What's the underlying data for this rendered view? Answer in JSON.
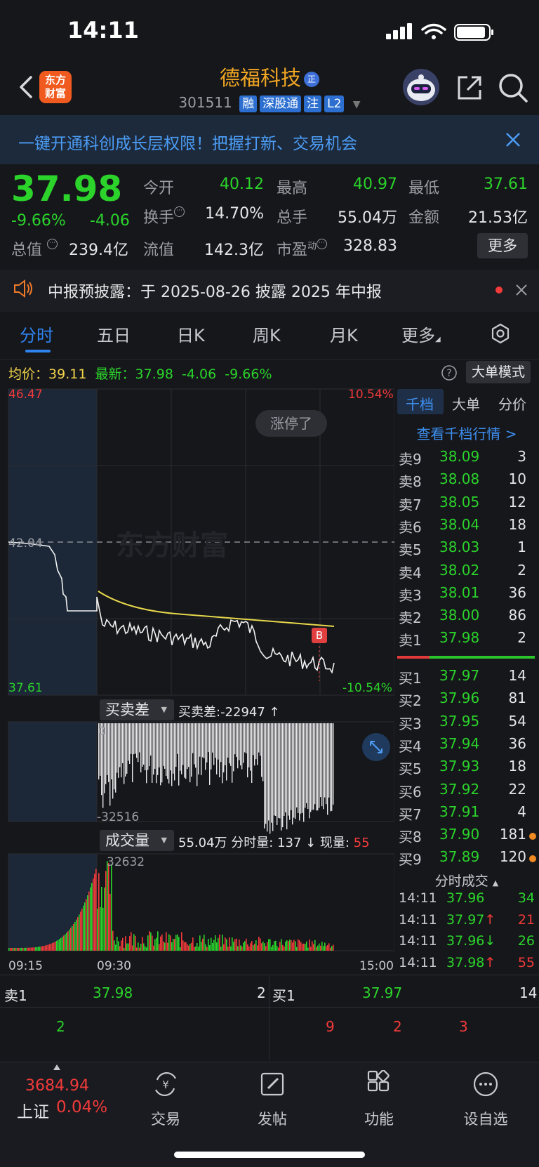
{
  "status": {
    "time": "14:11"
  },
  "header": {
    "logo_text_1": "东方",
    "logo_text_2": "财富",
    "stock_name": "德福科技",
    "name_badge": "正",
    "code": "301511",
    "tags": [
      "融",
      "深股通",
      "注",
      "L2"
    ]
  },
  "banner": {
    "text": "一键开通科创成长层权限！把握打新、交易机会"
  },
  "quote": {
    "price": "37.98",
    "pct": "-9.66%",
    "change": "-4.06",
    "market_cap_label": "总值",
    "market_cap": "239.4亿",
    "open_label": "今开",
    "open": "40.12",
    "high_label": "最高",
    "high": "40.97",
    "low_label": "最低",
    "low": "37.61",
    "turnover_label": "换手",
    "turnover": "14.70%",
    "volume_label": "总手",
    "volume": "55.04万",
    "amount_label": "金额",
    "amount": "21.53亿",
    "float_label": "流值",
    "float_cap": "142.3亿",
    "pe_label": "市盈",
    "pe_sup": "动",
    "pe": "328.83",
    "more_button": "更多"
  },
  "notice": {
    "text": "中报预披露：于 2025-08-26 披露 2025 年中报"
  },
  "tabs": [
    "分时",
    "五日",
    "日K",
    "周K",
    "月K",
    "更多"
  ],
  "avg_row": {
    "avg_label": "均价：",
    "avg": "39.11",
    "latest_label": "最新：",
    "latest": "37.98",
    "change": "-4.06",
    "pct": "-9.66%",
    "big_order_button": "大单模式"
  },
  "chart": {
    "top_price": "46.47",
    "top_pct": "10.54%",
    "bottom_price": "37.61",
    "bottom_pct": "-10.54%",
    "prev_close": "42.04",
    "limit_pill": "涨停了",
    "marker": "B",
    "diff_indicator": "买卖差",
    "diff_text": "买卖差:-22947 ↑",
    "diff_zero": "0",
    "diff_min": "-32516",
    "vol_indicator": "成交量",
    "vol_text_1": "55.04万 分时量: 137 ↓ 现量: ",
    "vol_now": "55",
    "vol_max": "32632",
    "time_start": "09:15",
    "time_open": "09:30",
    "time_end": "15:00",
    "watermark": "东方财富"
  },
  "colors": {
    "up": "#f23a3a",
    "down": "#2bd32b",
    "avg_line": "#e7d84b",
    "accent": "#2f83f0"
  },
  "side": {
    "tabs": [
      "千档",
      "大单",
      "分价"
    ],
    "link": "查看千档行情 >",
    "asks": [
      {
        "name": "卖9",
        "price": "38.09",
        "vol": "3"
      },
      {
        "name": "卖8",
        "price": "38.08",
        "vol": "10"
      },
      {
        "name": "卖7",
        "price": "38.05",
        "vol": "12"
      },
      {
        "name": "卖6",
        "price": "38.04",
        "vol": "18"
      },
      {
        "name": "卖5",
        "price": "38.03",
        "vol": "1"
      },
      {
        "name": "卖4",
        "price": "38.02",
        "vol": "2"
      },
      {
        "name": "卖3",
        "price": "38.01",
        "vol": "36"
      },
      {
        "name": "卖2",
        "price": "38.00",
        "vol": "86"
      },
      {
        "name": "卖1",
        "price": "37.98",
        "vol": "2"
      }
    ],
    "bids": [
      {
        "name": "买1",
        "price": "37.97",
        "vol": "14"
      },
      {
        "name": "买2",
        "price": "37.96",
        "vol": "81"
      },
      {
        "name": "买3",
        "price": "37.95",
        "vol": "54"
      },
      {
        "name": "买4",
        "price": "37.94",
        "vol": "36"
      },
      {
        "name": "买5",
        "price": "37.93",
        "vol": "18"
      },
      {
        "name": "买6",
        "price": "37.92",
        "vol": "22"
      },
      {
        "name": "买7",
        "price": "37.91",
        "vol": "4"
      },
      {
        "name": "买8",
        "price": "37.90",
        "vol": "181"
      },
      {
        "name": "买9",
        "price": "37.89",
        "vol": "120"
      }
    ],
    "ticks_title": "分时成交",
    "ticks": [
      {
        "time": "14:11",
        "price": "37.96",
        "arrow": "",
        "vol": "34",
        "dir": "down"
      },
      {
        "time": "14:11",
        "price": "37.97",
        "arrow": "↑",
        "vol": "21",
        "dir": "up"
      },
      {
        "time": "14:11",
        "price": "37.96",
        "arrow": "↓",
        "vol": "26",
        "dir": "down"
      },
      {
        "time": "14:11",
        "price": "37.98",
        "arrow": "↑",
        "vol": "55",
        "dir": "up"
      }
    ]
  },
  "strip": {
    "ask_label": "卖1",
    "ask_price": "37.98",
    "ask_vol": "2",
    "bid_label": "买1",
    "bid_price": "37.97",
    "bid_vol": "14",
    "ask_queue": [
      "2"
    ],
    "bid_queue": [
      "9",
      "2",
      "3"
    ]
  },
  "nav": {
    "index_value": "3684.94",
    "index_name": "上证",
    "index_pct": "0.04%",
    "items": [
      "交易",
      "发帖",
      "功能",
      "设自选"
    ]
  }
}
